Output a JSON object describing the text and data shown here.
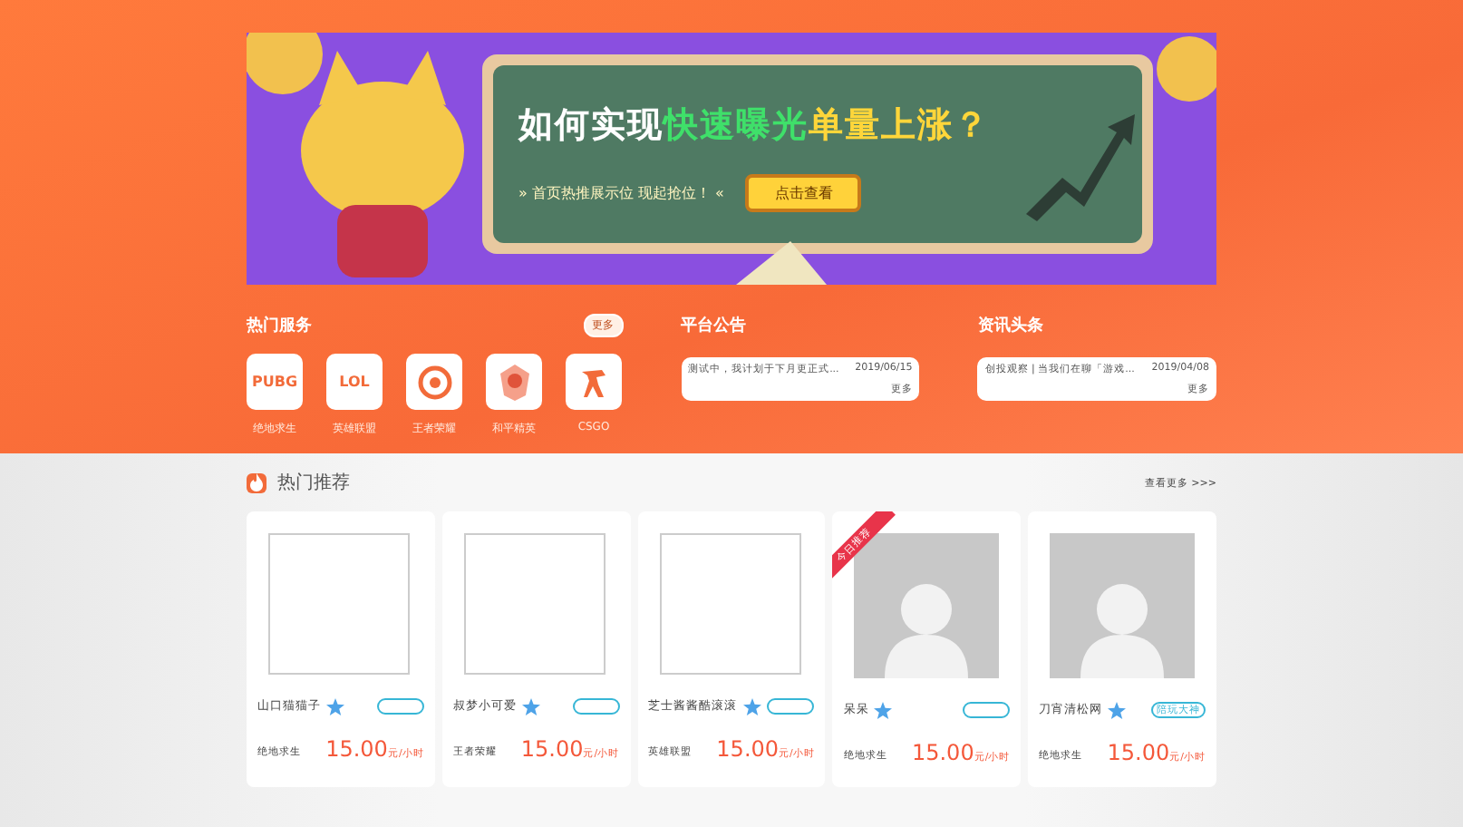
{
  "banner": {
    "headline_plain": "如何实现",
    "headline_green": "快速曝光",
    "headline_yellow": "单量上涨？",
    "subline": "» 首页热推展示位 现起抢位！ «",
    "button": "点击查看"
  },
  "services": {
    "title": "热门服务",
    "more": "更多",
    "items": [
      {
        "logo": "PUBG",
        "label": "绝地求生",
        "kind": "text"
      },
      {
        "logo": "LOL",
        "label": "英雄联盟",
        "kind": "text"
      },
      {
        "label": "王者荣耀",
        "kind": "ring"
      },
      {
        "label": "和平精英",
        "kind": "emblem"
      },
      {
        "label": "CSGO",
        "kind": "soldier"
      }
    ]
  },
  "notice": {
    "title": "平台公告",
    "text": "测试中，我计划于下月更正式...",
    "date": "2019/06/15",
    "more": "更多"
  },
  "news": {
    "title": "资讯头条",
    "text": "创投观察 | 当我们在聊「游戏...",
    "date": "2019/04/08",
    "more": "更多"
  },
  "recommend": {
    "title": "热门推荐",
    "more": "查看更多 >>>"
  },
  "cards": [
    {
      "name": "山口猫猫子",
      "game": "绝地求生",
      "price": "15.00",
      "unit": "元/小时",
      "kind": "broken",
      "pill": true
    },
    {
      "name": "叔梦小可爱",
      "game": "王者荣耀",
      "price": "15.00",
      "unit": "元/小时",
      "kind": "broken",
      "pill": true
    },
    {
      "name": "芝士酱酱酷滚滚",
      "game": "英雄联盟",
      "price": "15.00",
      "unit": "元/小时",
      "kind": "broken",
      "pill": true
    },
    {
      "name": "呆呆",
      "game": "绝地求生",
      "price": "15.00",
      "unit": "元/小时",
      "kind": "avatar",
      "pill": true,
      "ribbon": "今日推荐"
    },
    {
      "name": "刀宵清松网",
      "game": "绝地求生",
      "price": "15.00",
      "unit": "元/小时",
      "kind": "avatar",
      "pill": false,
      "pill_label": "陪玩大神"
    }
  ]
}
